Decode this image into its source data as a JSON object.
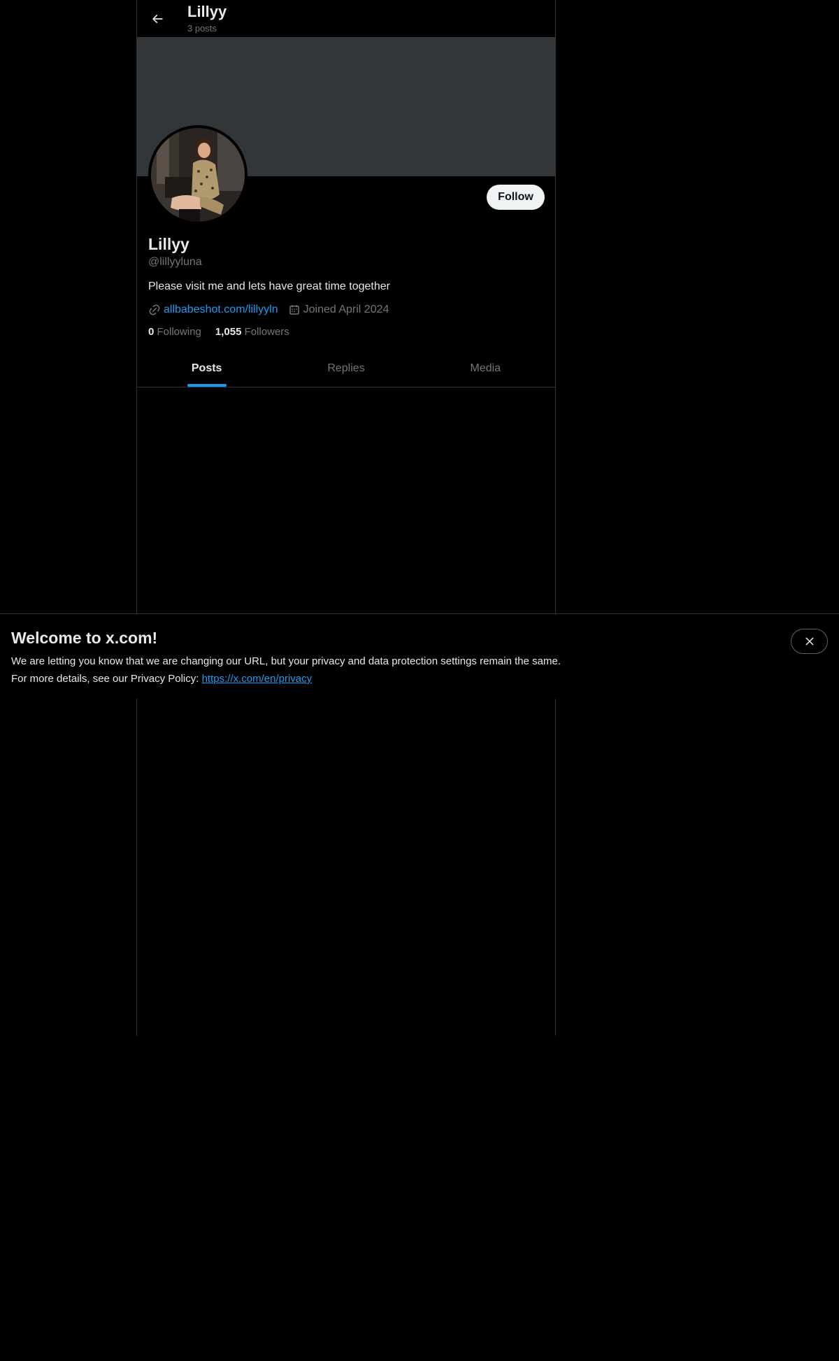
{
  "header": {
    "title": "Lillyy",
    "posts_count": "3 posts"
  },
  "profile": {
    "display_name": "Lillyy",
    "handle": "@lillyyluna",
    "bio": "Please visit me and lets have great time together",
    "link": "allbabeshot.com/lillyyln",
    "joined": "Joined April 2024",
    "following_count": "0",
    "following_label": "Following",
    "followers_count": "1,055",
    "followers_label": "Followers",
    "follow_button": "Follow"
  },
  "tabs": [
    {
      "label": "Posts",
      "active": true
    },
    {
      "label": "Replies",
      "active": false
    },
    {
      "label": "Media",
      "active": false
    }
  ],
  "welcome": {
    "title": "Welcome to x.com!",
    "line1": "We are letting you know that we are changing our URL, but your privacy and data protection settings remain the same.",
    "line2_prefix": "For more details, see our Privacy Policy: ",
    "privacy_link": "https://x.com/en/privacy"
  },
  "colors": {
    "background": "#000000",
    "banner": "#333639",
    "accent": "#1d9bf0",
    "border": "#2f3336",
    "muted_text": "#71767b"
  },
  "icons": [
    "back-arrow-icon",
    "link-icon",
    "calendar-icon",
    "close-icon"
  ]
}
